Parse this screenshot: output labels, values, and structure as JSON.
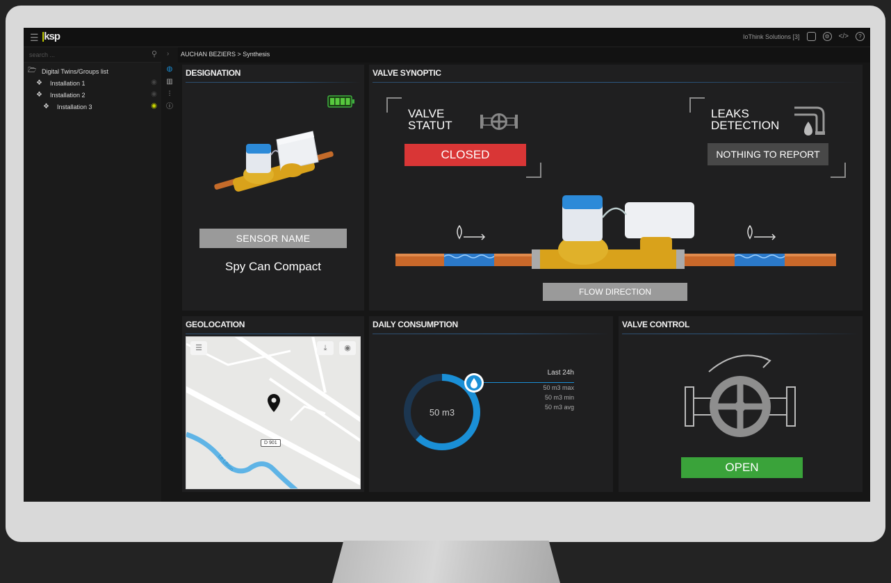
{
  "topbar": {
    "logo": "ksp",
    "account": "IoThink Solutions [3]"
  },
  "sidebar": {
    "search_placeholder": "search ...",
    "tree": [
      {
        "label": "Digital Twins/Groups list",
        "icon": "folder-icon",
        "level": 0
      },
      {
        "label": "Installation 1",
        "icon": "group-icon",
        "level": 1,
        "visible": false
      },
      {
        "label": "Installation 2",
        "icon": "group-icon",
        "level": 1,
        "visible": false
      },
      {
        "label": "Installation 3",
        "icon": "group-icon",
        "level": 2,
        "visible": true
      }
    ]
  },
  "breadcrumb": "AUCHAN BEZIERS > Synthesis",
  "designation": {
    "title": "DESIGNATION",
    "sensor_label": "SENSOR NAME",
    "sensor_value": "Spy Can Compact",
    "battery_level": 1.0
  },
  "valve_synoptic": {
    "title": "VALVE SYNOPTIC",
    "valve_label_1": "VALVE",
    "valve_label_2": "STATUT",
    "valve_status": "CLOSED",
    "leaks_label_1": "LEAKS",
    "leaks_label_2": "DETECTION",
    "leaks_status": "NOTHING TO REPORT",
    "flow_button": "FLOW DIRECTION"
  },
  "geolocation": {
    "title": "GEOLOCATION",
    "road_label": "D 901",
    "river_label": "Le Libron"
  },
  "daily_consumption": {
    "title": "DAILY CONSUMPTION",
    "value": "50 m3",
    "period": "Last 24h",
    "max": "50 m3 max",
    "min": "50 m3 min",
    "avg": "50 m3 avg",
    "progress": 0.62
  },
  "valve_control": {
    "title": "VALVE CONTROL",
    "button": "OPEN"
  },
  "colors": {
    "accent": "#c8d400",
    "closed": "#d93636",
    "open": "#3aa33a",
    "blue": "#1a8fd6"
  }
}
